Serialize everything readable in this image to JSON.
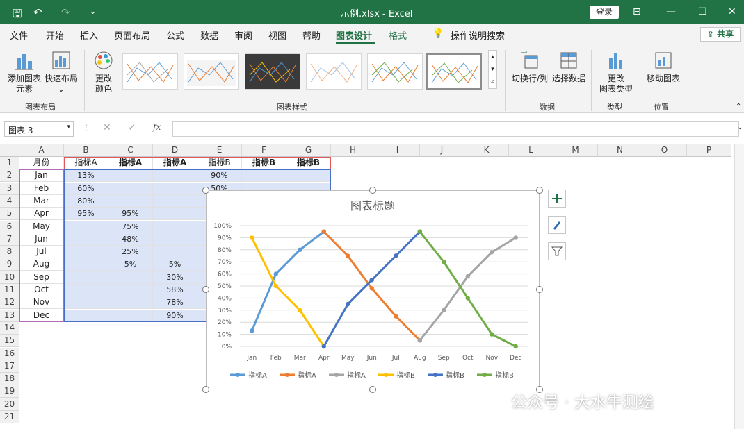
{
  "titlebar": {
    "filename": "示例.xlsx",
    "separator": "-",
    "app": "Excel",
    "login": "登录",
    "bg_color": "#217346"
  },
  "menubar": {
    "items": [
      "文件",
      "开始",
      "插入",
      "页面布局",
      "公式",
      "数据",
      "审阅",
      "视图",
      "帮助",
      "图表设计",
      "格式"
    ],
    "active": "图表设计",
    "search": "操作说明搜索",
    "share": "共享"
  },
  "ribbon": {
    "add_element": [
      "添加图表",
      "元素"
    ],
    "quick_layout": "快速布局",
    "change_color": [
      "更改",
      "颜色"
    ],
    "group_layouts": "图表布局",
    "group_styles": "图表样式",
    "switch_row_col": "切换行/列",
    "select_data": "选择数据",
    "group_data": "数据",
    "change_type": [
      "更改",
      "图表类型"
    ],
    "group_type": "类型",
    "move_chart": "移动图表",
    "group_location": "位置"
  },
  "formula_bar": {
    "name_box": "图表 3",
    "fx": "fx",
    "value": ""
  },
  "columns": [
    "A",
    "B",
    "C",
    "D",
    "E",
    "F",
    "G",
    "H",
    "I",
    "J",
    "K",
    "L",
    "M",
    "N",
    "O",
    "P"
  ],
  "rows": [
    "1",
    "2",
    "3",
    "4",
    "5",
    "6",
    "7",
    "8",
    "9",
    "10",
    "11",
    "12",
    "13",
    "14",
    "15",
    "16",
    "17",
    "18",
    "19",
    "20",
    "21"
  ],
  "cells": {
    "A": [
      "月份",
      "Jan",
      "Feb",
      "Mar",
      "Apr",
      "May",
      "Jun",
      "Jul",
      "Aug",
      "Sep",
      "Oct",
      "Nov",
      "Dec"
    ],
    "B": [
      "指标A",
      "13%",
      "60%",
      "80%",
      "95%",
      "",
      "",
      "",
      "",
      "",
      "",
      "",
      ""
    ],
    "C": [
      "指标A",
      "",
      "",
      "",
      "95%",
      "75%",
      "48%",
      "25%",
      "5%",
      "",
      "",
      "",
      ""
    ],
    "D": [
      "指标A",
      "",
      "",
      "",
      "",
      "",
      "",
      "",
      "5%",
      "30%",
      "58%",
      "78%",
      "90%"
    ],
    "E": [
      "指标B",
      "90%",
      "50%",
      "",
      "",
      "",
      "",
      "",
      "",
      "",
      "",
      "",
      ""
    ],
    "F": [
      "指标B",
      "",
      "",
      "",
      "",
      "",
      "",
      "",
      "",
      "",
      "",
      "",
      ""
    ],
    "G": [
      "指标B",
      "",
      "",
      "",
      "",
      "",
      "",
      "",
      "",
      "",
      "",
      "",
      ""
    ]
  },
  "chart_data": {
    "type": "line",
    "title": "图表标题",
    "categories": [
      "Jan",
      "Feb",
      "Mar",
      "Apr",
      "May",
      "Jun",
      "Jul",
      "Aug",
      "Sep",
      "Oct",
      "Nov",
      "Dec"
    ],
    "y_ticks": [
      "0%",
      "10%",
      "20%",
      "30%",
      "40%",
      "50%",
      "60%",
      "70%",
      "80%",
      "90%",
      "100%"
    ],
    "ylim": [
      0,
      100
    ],
    "grid": true,
    "legend_position": "bottom",
    "series": [
      {
        "name": "指标A",
        "color": "#5b9bd5",
        "values": [
          13,
          60,
          80,
          95,
          null,
          null,
          null,
          null,
          null,
          null,
          null,
          null
        ]
      },
      {
        "name": "指标A",
        "color": "#ed7d31",
        "values": [
          null,
          null,
          null,
          95,
          75,
          48,
          25,
          5,
          null,
          null,
          null,
          null
        ]
      },
      {
        "name": "指标A",
        "color": "#a5a5a5",
        "values": [
          null,
          null,
          null,
          null,
          null,
          null,
          null,
          5,
          30,
          58,
          78,
          90
        ]
      },
      {
        "name": "指标B",
        "color": "#ffc000",
        "values": [
          90,
          50,
          30,
          0,
          null,
          null,
          null,
          null,
          null,
          null,
          null,
          null
        ]
      },
      {
        "name": "指标B",
        "color": "#4472c4",
        "values": [
          null,
          null,
          null,
          0,
          35,
          55,
          75,
          95,
          null,
          null,
          null,
          null
        ]
      },
      {
        "name": "指标B",
        "color": "#70ad47",
        "values": [
          null,
          null,
          null,
          null,
          null,
          null,
          null,
          95,
          70,
          40,
          10,
          0
        ]
      }
    ]
  },
  "watermark": "公众号 · 大水牛测绘"
}
